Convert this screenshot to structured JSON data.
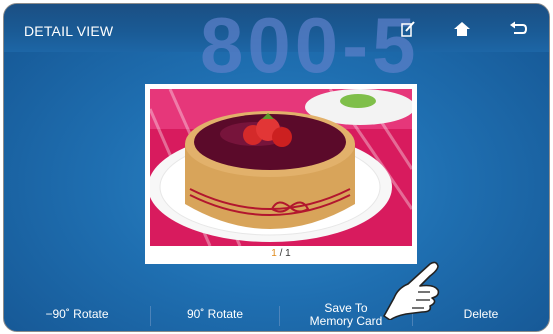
{
  "header": {
    "title": "DETAIL VIEW",
    "watermark": "800-5",
    "icons": [
      "edit-icon",
      "home-icon",
      "back-icon"
    ]
  },
  "photo": {
    "counter_current": "1",
    "counter_sep": "/",
    "counter_total": "1"
  },
  "actions": {
    "rotate_left": "−90˚ Rotate",
    "rotate_right": "90˚ Rotate",
    "save_line1": "Save To",
    "save_line2": "Memory Card",
    "delete": "Delete"
  },
  "colors": {
    "accent_orange": "#e08a1c",
    "background_blue": "#1f6fb1"
  }
}
